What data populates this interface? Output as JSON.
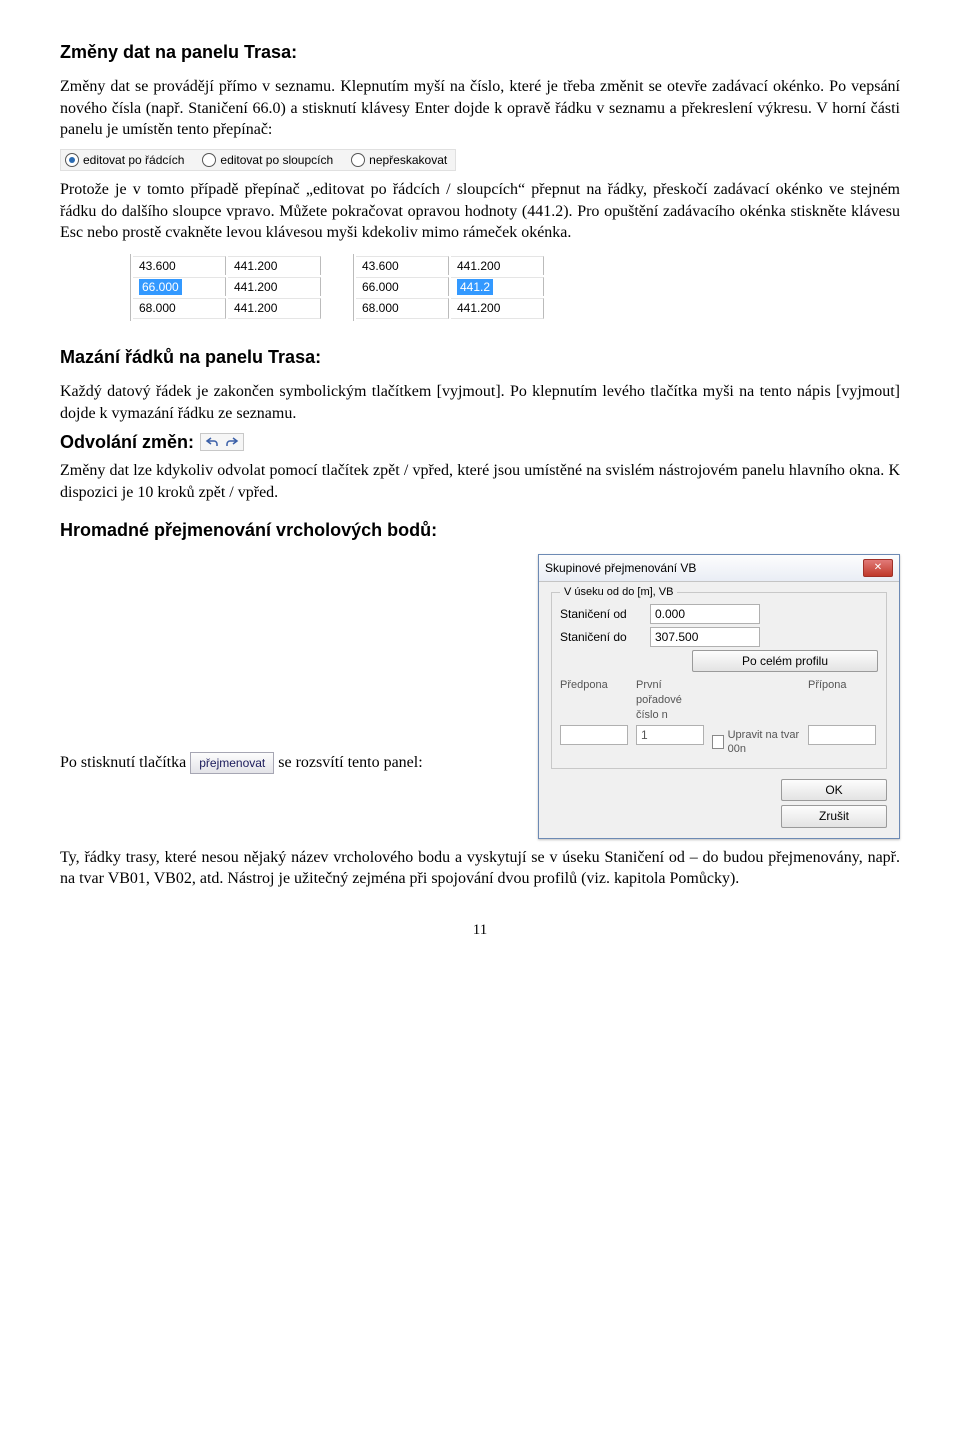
{
  "s1": {
    "heading": "Změny dat na panelu Trasa:",
    "p1": "Změny dat se provádějí přímo v seznamu. Klepnutím myší na číslo, které je třeba změnit se otevře zadávací okénko. Po vepsání nového čísla (např. Staničení 66.0) a stisknutí klávesy Enter dojde k opravě řádku v seznamu a překreslení výkresu. V horní části panelu je umístěn tento přepínač:",
    "radio": {
      "opt1": "editovat po řádcích",
      "opt2": "editovat po sloupcích",
      "opt3": "nepřeskakovat"
    },
    "p2": "Protože je v tomto případě přepínač „editovat po řádcích / sloupcích“ přepnut na řádky, přeskočí zadávací okénko ve stejném řádku do dalšího sloupce vpravo. Můžete pokračovat opravou hodnoty (441.2). Pro opuštění zadávacího okénka stiskněte klávesu Esc nebo prostě cvakněte levou klávesou myši kdekoliv mimo rámeček okénka."
  },
  "grids": {
    "left": {
      "r1c1": "43.600",
      "r1c2": "441.200",
      "r2c1": "66.000",
      "r2c2": "441.200",
      "r3c1": "68.000",
      "r3c2": "441.200"
    },
    "right": {
      "r1c1": "43.600",
      "r1c2": "441.200",
      "r2c1": "66.000",
      "r2c2": "441.200",
      "r3c1": "68.000",
      "r3c2": "441.200",
      "sel": "441.2"
    }
  },
  "s2": {
    "heading": "Mazání řádků na panelu Trasa:",
    "p1": "Každý datový řádek je zakončen symbolickým tlačítkem [vyjmout]. Po klepnutím levého tlačítka myši na tento nápis [vyjmout] dojde k vymazání řádku ze seznamu."
  },
  "s3": {
    "heading": "Odvolání změn:",
    "p1": "Změny dat lze kdykoliv odvolat pomocí tlačítek zpět / vpřed, které jsou umístěné na svislém nástrojovém panelu hlavního okna. K dispozici je 10 kroků zpět / vpřed."
  },
  "s4": {
    "heading": "Hromadné přejmenování vrcholových bodů:"
  },
  "dialog": {
    "title": "Skupinové přejmenování VB",
    "fs_legend": "V úseku od do [m], VB",
    "lbl_from": "Staničení od",
    "lbl_to": "Staničení do",
    "val_from": "0.000",
    "val_to": "307.500",
    "btn_full": "Po celém profilu",
    "col_predpona": "Předpona",
    "col_cislo_line1": "První",
    "col_cislo_line2": "pořadové",
    "col_cislo_line3": "číslo n",
    "col_pripona": "Přípona",
    "cislo_val": "1",
    "chk_label": "Upravit na tvar 00n",
    "btn_ok": "OK",
    "btn_cancel": "Zrušit"
  },
  "s5": {
    "intro_a": "Po stisknutí tlačítka ",
    "rename_btn": "přejmenovat",
    "intro_b": " se rozsvítí tento panel: ",
    "p1": "Ty, řádky trasy, které nesou nějaký název vrcholového bodu a vyskytují se v úseku Staničení od – do budou přejmenovány, např. na tvar VB01, VB02, atd. Nástroj je užitečný zejména při spojování dvou profilů (viz. kapitola Pomůcky)."
  },
  "page_number": "11"
}
